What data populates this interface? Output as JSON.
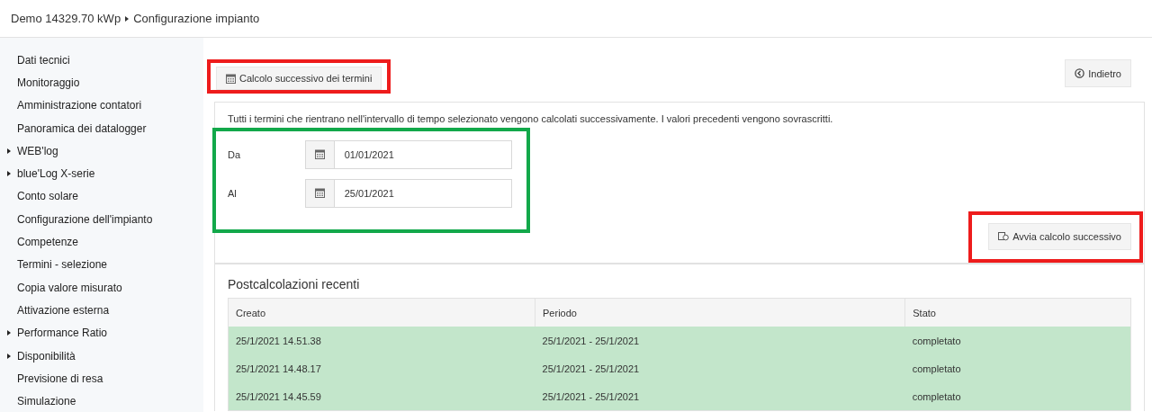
{
  "breadcrumb": {
    "plant": "Demo 14329.70 kWp",
    "page": "Configurazione impianto"
  },
  "sidebar": {
    "items": [
      {
        "label": "Dati tecnici",
        "expandable": false
      },
      {
        "label": "Monitoraggio",
        "expandable": false
      },
      {
        "label": "Amministrazione contatori",
        "expandable": false
      },
      {
        "label": "Panoramica dei datalogger",
        "expandable": false
      },
      {
        "label": "WEB'log",
        "expandable": true
      },
      {
        "label": "blue'Log X-serie",
        "expandable": true
      },
      {
        "label": "Conto solare",
        "expandable": false
      },
      {
        "label": "Configurazione dell'impianto",
        "expandable": false
      },
      {
        "label": "Competenze",
        "expandable": false
      },
      {
        "label": "Termini - selezione",
        "expandable": false
      },
      {
        "label": "Copia valore misurato",
        "expandable": false
      },
      {
        "label": "Attivazione esterna",
        "expandable": false
      },
      {
        "label": "Performance Ratio",
        "expandable": true
      },
      {
        "label": "Disponibilità",
        "expandable": true
      },
      {
        "label": "Previsione di resa",
        "expandable": false
      },
      {
        "label": "Simulazione",
        "expandable": false
      }
    ]
  },
  "toolbar": {
    "calc_button": {
      "label": "Calcolo successivo dei termini",
      "color": "#ee1c1c"
    },
    "back_button": {
      "label": "Indietro"
    }
  },
  "form": {
    "description": "Tutti i termini che rientrano nell'intervallo di tempo selezionato vengono calcolati successivamente. I valori precedenti vengono sovrascritti.",
    "color": "#12a84a",
    "fields": [
      {
        "label": "Da",
        "value": "01/01/2021"
      },
      {
        "label": "Al",
        "value": "25/01/2021"
      }
    ],
    "start_button": {
      "label": "Avvia calcolo successivo",
      "color": "#ee1c1c"
    }
  },
  "recent": {
    "title": "Postcalcolazioni recenti",
    "table": {
      "columns": [
        "Creato",
        "Periodo",
        "Stato"
      ],
      "rows": [
        {
          "cells": [
            "25/1/2021 14.51.38",
            "25/1/2021 - 25/1/2021",
            "completato"
          ]
        },
        {
          "cells": [
            "25/1/2021 14.48.17",
            "25/1/2021 - 25/1/2021",
            "completato"
          ]
        },
        {
          "cells": [
            "25/1/2021 14.45.59",
            "25/1/2021 - 25/1/2021",
            "completato"
          ]
        }
      ]
    }
  }
}
